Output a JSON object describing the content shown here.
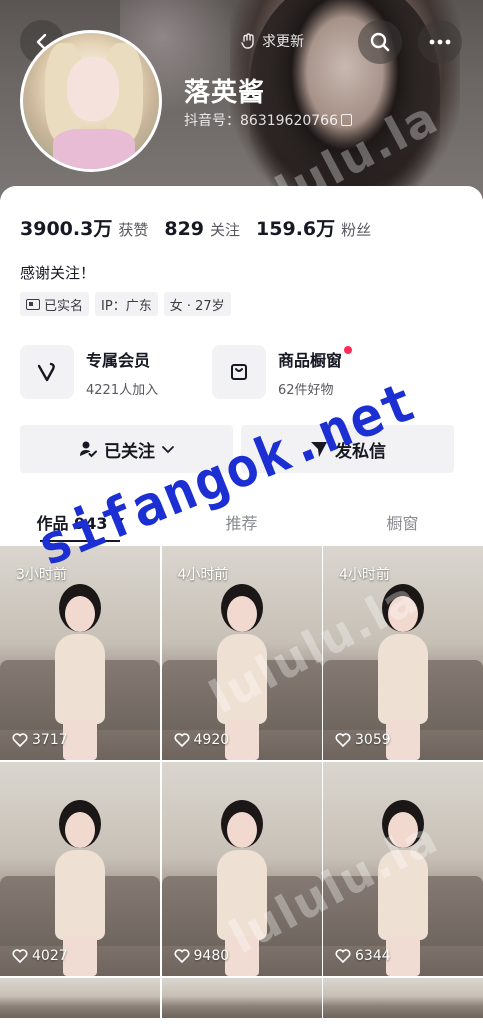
{
  "header": {
    "update_label": "求更新",
    "nickname": "落英酱",
    "douyin_id_label": "抖音号：",
    "douyin_id": "86319620766"
  },
  "stats": [
    {
      "num": "3900.3万",
      "label": "获赞"
    },
    {
      "num": "829",
      "label": "关注"
    },
    {
      "num": "159.6万",
      "label": "粉丝"
    }
  ],
  "bio": "感谢关注！",
  "tags": {
    "verified": "已实名",
    "ip": "IP：广东",
    "gender_age": "女 · 27岁"
  },
  "services": {
    "member_title": "专属会员",
    "member_sub": "4221人加入",
    "shop_title": "商品橱窗",
    "shop_sub": "62件好物"
  },
  "actions": {
    "follow_label": "已关注",
    "message_label": "发私信"
  },
  "tabs": {
    "works": "作品 943",
    "recommend": "推荐",
    "showcase": "橱窗"
  },
  "videos": [
    {
      "time": "3小时前",
      "likes": "3717"
    },
    {
      "time": "4小时前",
      "likes": "4920"
    },
    {
      "time": "4小时前",
      "likes": "3059"
    },
    {
      "time": "",
      "likes": "4027"
    },
    {
      "time": "",
      "likes": "9480"
    },
    {
      "time": "",
      "likes": "6344"
    }
  ],
  "watermarks": {
    "main": "sifangok.net",
    "faint": "lululu.la"
  },
  "colors": {
    "accent_red": "#fe2c55",
    "watermark_blue": "#1b2fd3",
    "chip_bg": "#f2f2f4"
  }
}
